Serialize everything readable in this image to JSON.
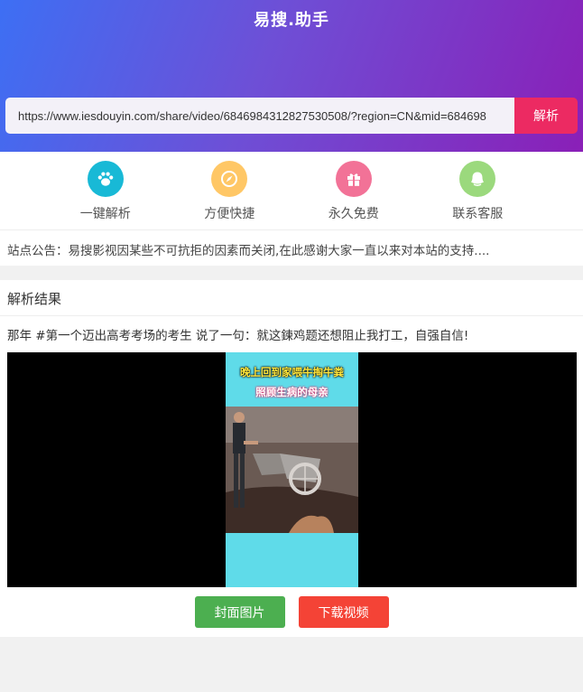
{
  "header": {
    "brand": "易搜.助手",
    "url_value": "https://www.iesdouyin.com/share/video/6846984312827530508/?region=CN&mid=684698",
    "parse_button": "解析"
  },
  "features": [
    {
      "label": "一键解析",
      "icon": "paw-icon",
      "color": "#18b9d6"
    },
    {
      "label": "方便快捷",
      "icon": "compass-icon",
      "color": "#ffc766"
    },
    {
      "label": "永久免费",
      "icon": "gift-icon",
      "color": "#f27297"
    },
    {
      "label": "联系客服",
      "icon": "customer-service-icon",
      "color": "#9bd97d"
    }
  ],
  "notice": {
    "label": "站点公告：",
    "text": "易搜影视因某些不可抗拒的因素而关闭,在此感谢大家一直以来对本站的支持...."
  },
  "result": {
    "title": "解析结果",
    "video_title": "那年 #第一个迈出高考考场的考生 说了一句：就这鍊鸡题还想阻止我打工，自强自信!",
    "caption_line1": "晚上回到家喂牛掏牛粪",
    "caption_line2": "照顾生病的母亲",
    "cover_button": "封面图片",
    "download_button": "下载视频"
  }
}
